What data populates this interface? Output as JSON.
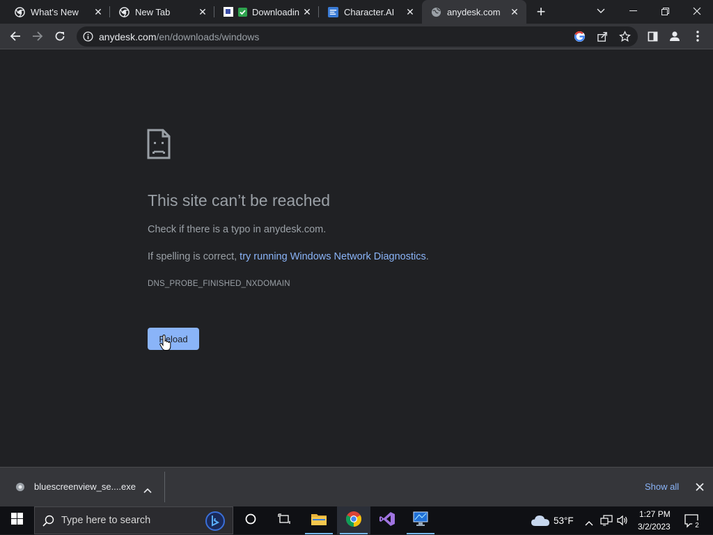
{
  "browser": {
    "tabs": [
      {
        "title": "What's New",
        "icon": "chrome-icon"
      },
      {
        "title": "New Tab",
        "icon": "chrome-icon"
      },
      {
        "title": "Downloadin",
        "icon": "check-icon"
      },
      {
        "title": "Character.AI",
        "icon": "character-ai-icon"
      },
      {
        "title": "anydesk.com",
        "icon": "globe-icon",
        "active": true
      }
    ],
    "new_tab_symbol": "+",
    "address": {
      "host": "anydesk.com",
      "path": "/en/downloads/windows"
    }
  },
  "error_page": {
    "title": "This site can’t be reached",
    "line1": "Check if there is a typo in anydesk.com.",
    "line2_prefix": "If spelling is correct, ",
    "line2_link": "try running Windows Network Diagnostics",
    "line2_suffix": ".",
    "code": "DNS_PROBE_FINISHED_NXDOMAIN",
    "reload_label": "Reload"
  },
  "download_shelf": {
    "file_name": "bluescreenview_se....exe",
    "show_all": "Show all"
  },
  "taskbar": {
    "search_placeholder": "Type here to search",
    "weather": "53°F",
    "time": "1:27 PM",
    "date": "3/2/2023",
    "notification_count": "2"
  },
  "colors": {
    "accent": "#8ab4f8",
    "page_bg": "#202124",
    "toolbar_bg": "#35363a"
  }
}
